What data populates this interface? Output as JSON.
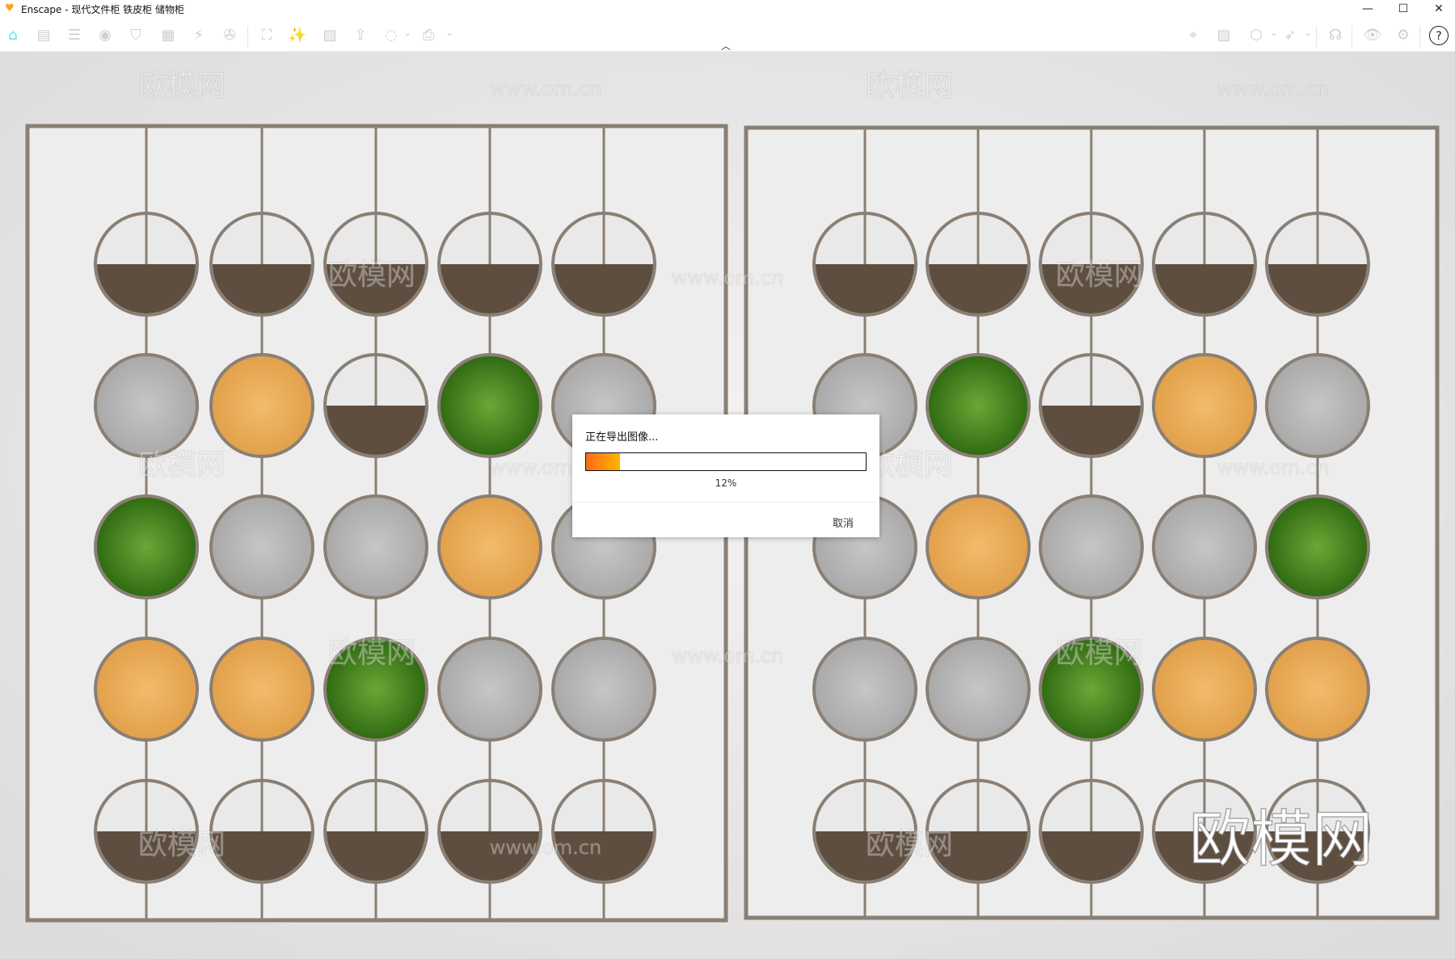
{
  "window": {
    "title": "Enscape - 现代文件柜 铁皮柜 储物柜",
    "minimize": "—",
    "maximize": "☐",
    "close": "✕"
  },
  "toolbar": {
    "left": [
      {
        "name": "home-icon",
        "glyph": "⌂"
      },
      {
        "name": "notes-icon",
        "glyph": "▤"
      },
      {
        "name": "bim-icon",
        "glyph": "☰"
      },
      {
        "name": "view-icon",
        "glyph": "◉"
      },
      {
        "name": "shield-icon",
        "glyph": "⛉"
      },
      {
        "name": "building-icon",
        "glyph": "▦"
      },
      {
        "name": "building-flash-icon",
        "glyph": "⚡"
      },
      {
        "name": "video-reel-icon",
        "glyph": "✇"
      },
      {
        "name": "screenshot-icon",
        "glyph": "⛶"
      },
      {
        "name": "magic-wand-icon",
        "glyph": "✨"
      },
      {
        "name": "image-icon",
        "glyph": "▨"
      },
      {
        "name": "export-file-icon",
        "glyph": "⇪"
      },
      {
        "name": "panorama-360-icon",
        "glyph": "◌"
      },
      {
        "name": "exr-export-icon",
        "glyph": "⎙"
      }
    ],
    "right": [
      {
        "name": "map-location-icon",
        "glyph": "⌖"
      },
      {
        "name": "image-panel-icon",
        "glyph": "▨"
      },
      {
        "name": "box-icon",
        "glyph": "⬡"
      },
      {
        "name": "wing-icon",
        "glyph": "➶"
      },
      {
        "name": "vr-headset-icon",
        "glyph": "☊"
      },
      {
        "name": "eye-settings-icon",
        "glyph": "👁"
      },
      {
        "name": "gear-icon",
        "glyph": "⚙"
      },
      {
        "name": "help-icon",
        "glyph": "?"
      }
    ]
  },
  "watermark": {
    "brand": "欧模网",
    "url": "www.om.cn"
  },
  "dialog": {
    "title": "正在导出图像...",
    "progress_percent": 12,
    "progress_label": "12%",
    "cancel": "取消",
    "gradient_start": "#ff6a1a",
    "gradient_end": "#ffb400"
  },
  "colors": {
    "frame": "#8a7f74",
    "brown": "#5e4e40",
    "gray": "#b9b9b9",
    "orange": "#e9ac5a",
    "moss": "#4e8a23"
  }
}
